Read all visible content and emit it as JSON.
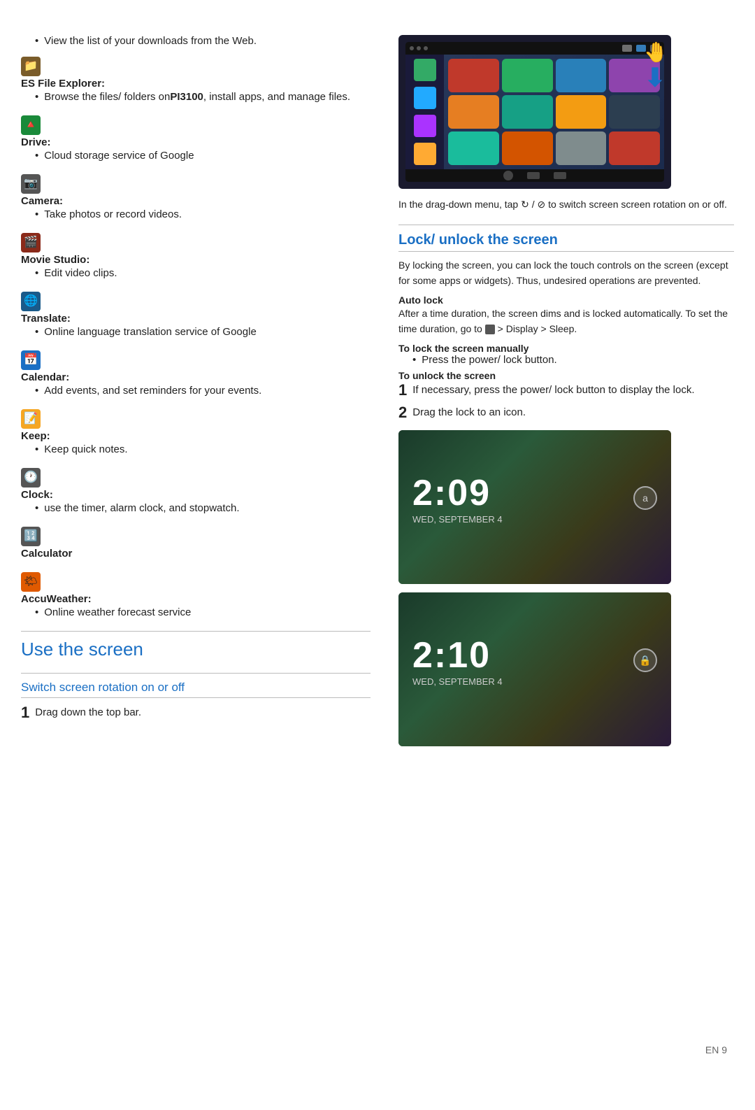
{
  "left": {
    "downloads_bullet": "View the list of your downloads from the Web.",
    "apps": [
      {
        "id": "es-file-explorer",
        "icon_color": "#7a5c2a",
        "icon_char": "📁",
        "name": "ES File Explorer",
        "name_suffix": "",
        "bullets": [
          "Browse the files/ folders on PI3100, install apps, and manage files."
        ]
      },
      {
        "id": "drive",
        "icon_color": "#1a8a3a",
        "icon_char": "▲",
        "name": "Drive",
        "bullets": [
          "Cloud storage service of Google"
        ]
      },
      {
        "id": "camera",
        "icon_color": "#555",
        "icon_char": "📷",
        "name": "Camera",
        "bullets": [
          "Take photos or record videos."
        ]
      },
      {
        "id": "movie-studio",
        "icon_color": "#8a2a1a",
        "icon_char": "🎬",
        "name": "Movie Studio",
        "bullets": [
          "Edit video clips."
        ]
      },
      {
        "id": "translate",
        "icon_color": "#1a5a8a",
        "icon_char": "🌐",
        "name": "Translate",
        "bullets": [
          "Online language translation service of Google"
        ]
      },
      {
        "id": "calendar",
        "icon_color": "#1a6fc4",
        "icon_char": "📅",
        "name": "Calendar",
        "bullets": [
          "Add events, and set reminders for your events."
        ]
      },
      {
        "id": "keep",
        "icon_color": "#f5a623",
        "icon_char": "📝",
        "name": "Keep",
        "bullets": [
          "Keep quick notes."
        ]
      },
      {
        "id": "clock",
        "icon_color": "#555",
        "icon_char": "🕐",
        "name": "Clock",
        "bullets": [
          "use the timer, alarm clock, and stopwatch."
        ]
      },
      {
        "id": "calculator",
        "icon_color": "#555",
        "icon_char": "🔢",
        "name": "Calculator",
        "bullets": []
      },
      {
        "id": "accuweather",
        "icon_color": "#e05a00",
        "icon_char": "⛅",
        "name": "AccuWeather",
        "bullets": [
          "Online weather forecast service"
        ]
      }
    ],
    "use_screen_title": "Use the screen",
    "switch_rotation_title": "Switch screen rotation on or off",
    "step1_label": "1",
    "step1_text": "Drag down the top bar."
  },
  "right": {
    "caption": "In the drag-down menu, tap ⟳ / ⊗ to switch screen screen rotation on or off.",
    "lock_section_title": "Lock/ unlock the screen",
    "lock_body": "By locking the screen, you can lock the touch controls on the screen (except for some apps or widgets). Thus, undesired operations are prevented.",
    "auto_lock_label": "Auto lock",
    "auto_lock_text": "After a time duration, the screen dims and is locked automatically. To set the time duration, go to",
    "auto_lock_path": " > Display > Sleep.",
    "lock_manually_label": "To lock the screen manually",
    "lock_manually_bullet": "Press the power/ lock button.",
    "unlock_label": "To unlock the screen",
    "step1_label": "1",
    "step1_text": "If necessary, press the power/ lock button to display the lock.",
    "step2_label": "2",
    "step2_text": "Drag the lock to an icon.",
    "lock_time_1": "2:09",
    "lock_date_1": "WED, SEPTEMBER 4",
    "lock_time_2": "2:10",
    "lock_date_2": "WED, SEPTEMBER 4"
  },
  "page_number": "EN   9"
}
